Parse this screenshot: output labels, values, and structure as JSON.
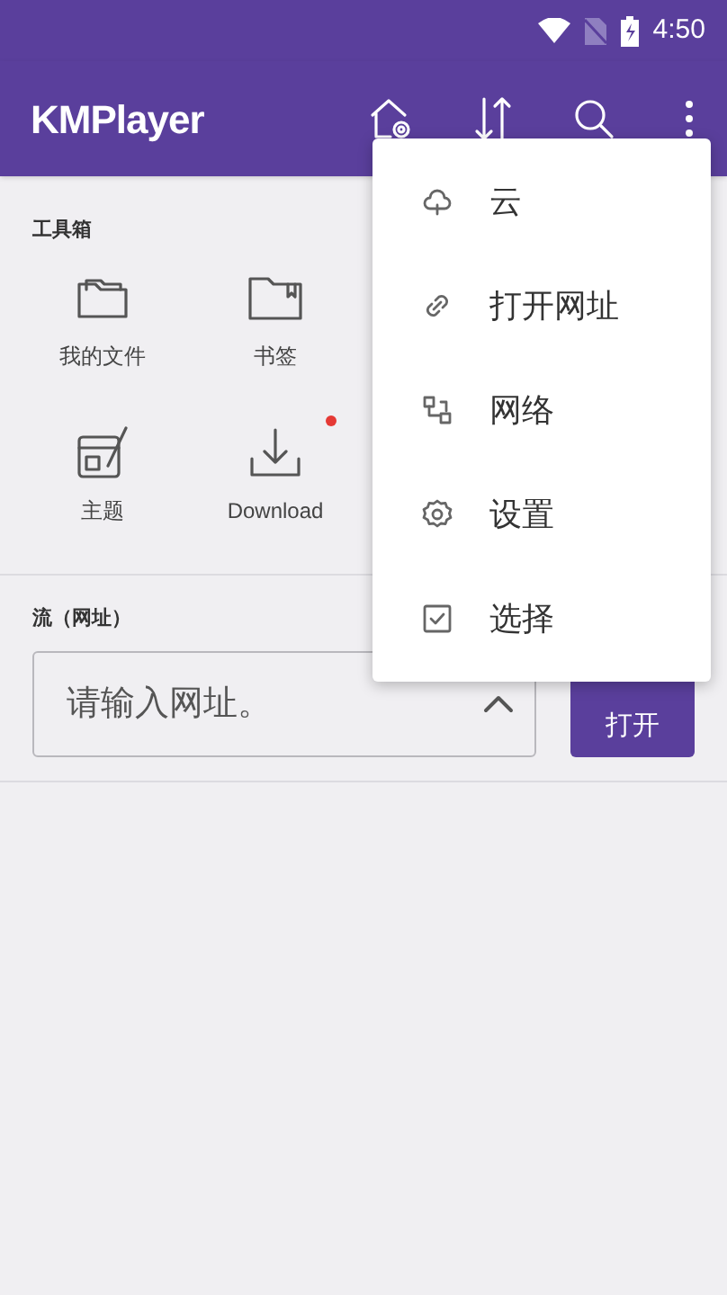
{
  "status_bar": {
    "time": "4:50"
  },
  "app_bar": {
    "title": "KMPlayer"
  },
  "toolbox": {
    "title": "工具箱",
    "items": [
      {
        "label": "我的文件",
        "notification_dot": false
      },
      {
        "label": "书签",
        "notification_dot": false
      },
      {
        "label": "主题",
        "notification_dot": false
      },
      {
        "label": "Download",
        "notification_dot": true
      }
    ]
  },
  "stream": {
    "title": "流（网址）",
    "placeholder": "请输入网址。",
    "open_button": "打开"
  },
  "menu": {
    "items": [
      {
        "label": "云"
      },
      {
        "label": "打开网址"
      },
      {
        "label": "网络"
      },
      {
        "label": "设置"
      },
      {
        "label": "选择"
      }
    ]
  }
}
